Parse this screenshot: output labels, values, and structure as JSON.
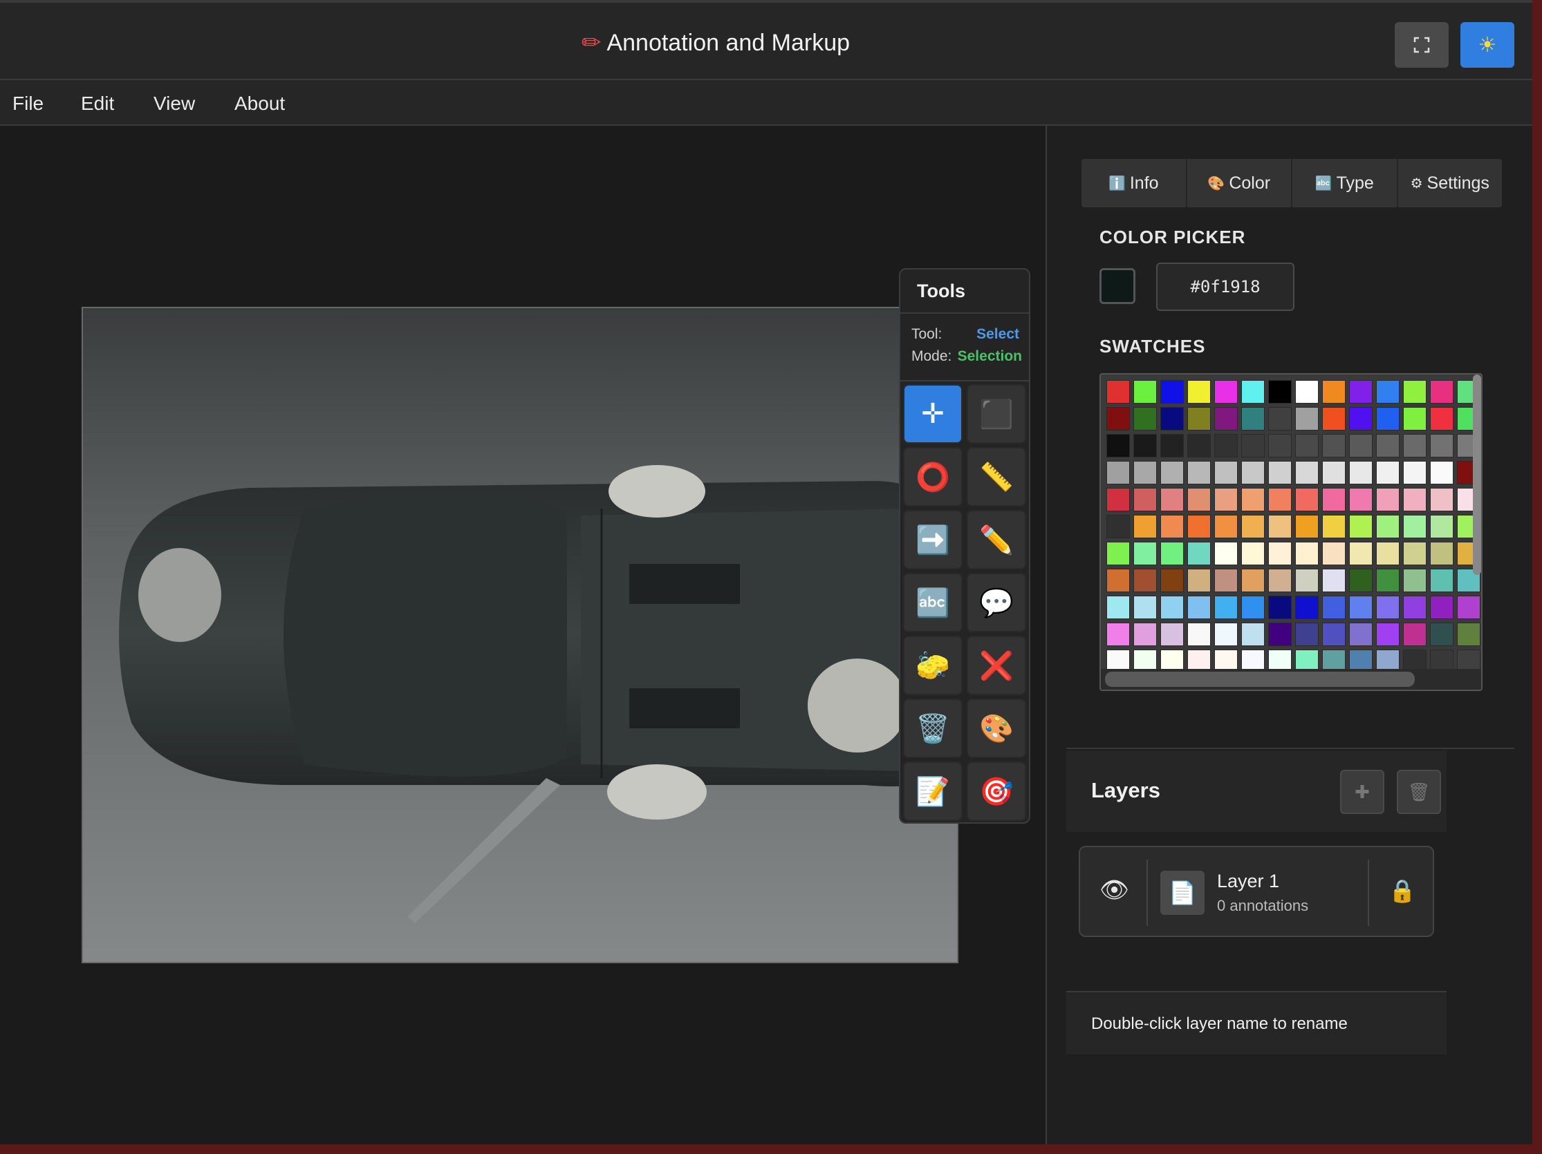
{
  "window": {
    "title": "Annotation and Markup",
    "title_icon": "pencil-icon",
    "fullscreen_icon": "fullscreen-icon",
    "theme_icon": "sun-icon"
  },
  "menu": [
    "File",
    "Edit",
    "View",
    "About"
  ],
  "tools_panel": {
    "title": "Tools",
    "tool_label": "Tool:",
    "tool_value": "Select",
    "mode_label": "Mode:",
    "mode_value": "Selection",
    "tools": [
      {
        "name": "select",
        "icon": "✛",
        "active": true
      },
      {
        "name": "rectangle",
        "icon": "⬛"
      },
      {
        "name": "circle",
        "icon": "⭕"
      },
      {
        "name": "line",
        "icon": "📏"
      },
      {
        "name": "arrow",
        "icon": "➡️"
      },
      {
        "name": "pencil",
        "icon": "✏️"
      },
      {
        "name": "text",
        "icon": "🔤"
      },
      {
        "name": "callout",
        "icon": "💬"
      },
      {
        "name": "eraser",
        "icon": "🧽"
      },
      {
        "name": "delete",
        "icon": "❌"
      },
      {
        "name": "trash",
        "icon": "🗑️"
      },
      {
        "name": "palette",
        "icon": "🎨"
      },
      {
        "name": "notes",
        "icon": "📝"
      },
      {
        "name": "target",
        "icon": "🎯"
      }
    ]
  },
  "sidebar": {
    "tabs": [
      {
        "icon": "ℹ️",
        "label": "Info"
      },
      {
        "icon": "🎨",
        "label": "Color"
      },
      {
        "icon": "🔤",
        "label": "Type"
      },
      {
        "icon": "⚙",
        "label": "Settings"
      }
    ],
    "color_picker_title": "COLOR PICKER",
    "current_color": "#0f1918",
    "swatches_title": "SWATCHES",
    "swatches": [
      [
        "#e03030",
        "#6cf040",
        "#1010e8",
        "#f0f030",
        "#e830e8",
        "#60f0f0",
        "#000000",
        "#ffffff",
        "#f08a20",
        "#8020e8",
        "#3080f0",
        "#90f040",
        "#e83080",
        "#60e080"
      ],
      [
        "#801010",
        "#307020",
        "#0a0a80",
        "#808020",
        "#801880",
        "#308080",
        "#404040",
        "#a0a0a0",
        "#f05020",
        "#5010f0",
        "#2060f0",
        "#80f040",
        "#f03040",
        "#50e060"
      ],
      [
        "#101010",
        "#1a1a1a",
        "#222222",
        "#2a2a2a",
        "#323232",
        "#3a3a3a",
        "#424242",
        "#4a4a4a",
        "#525252",
        "#5a5a5a",
        "#626262",
        "#6a6a6a",
        "#727272",
        "#7a7a7a"
      ],
      [
        "#a0a0a0",
        "#a8a8a8",
        "#b0b0b0",
        "#b8b8b8",
        "#c0c0c0",
        "#c8c8c8",
        "#d0d0d0",
        "#d8d8d8",
        "#e0e0e0",
        "#e8e8e8",
        "#f0f0f0",
        "#f4f4f4",
        "#fafafa",
        "#801010"
      ],
      [
        "#d03040",
        "#d06060",
        "#e08080",
        "#e09070",
        "#e8a080",
        "#f0a070",
        "#f08060",
        "#f06a60",
        "#f06aa0",
        "#f07ab0",
        "#f0a0b8",
        "#f0b0c0",
        "#f0c0c8",
        "#f8e0e8"
      ],
      [
        "#303030",
        "#f0a030",
        "#f08a50",
        "#f07030",
        "#f09040",
        "#f0b050",
        "#f0c080",
        "#f0a020",
        "#f0d040",
        "#b0f050",
        "#a0f080",
        "#a0f0a0",
        "#b0e8a0",
        "#a0f060"
      ],
      [
        "#80f050",
        "#80f0a0",
        "#70f080",
        "#70d8c0",
        "#fffff0",
        "#fff8d8",
        "#fff0d8",
        "#fff0d0",
        "#f8e0c0",
        "#f0e8b0",
        "#e8e0a0",
        "#d0d090",
        "#c0c080",
        "#e0b040"
      ],
      [
        "#d07030",
        "#a05030",
        "#804010",
        "#d0b080",
        "#c09080",
        "#e0a060",
        "#d0b090",
        "#d0d0c0",
        "#e0e0f0",
        "#306020",
        "#409040",
        "#90c090",
        "#60c0b0",
        "#60c0c0"
      ],
      [
        "#a0e8f0",
        "#b0e0f0",
        "#90d0f0",
        "#80c0f0",
        "#40b0f0",
        "#3090f0",
        "#0a0a80",
        "#1010d0",
        "#4060e0",
        "#6080f0",
        "#8070f0",
        "#9040e0",
        "#9020c0",
        "#b040d0"
      ],
      [
        "#f080e8",
        "#e0a0e0",
        "#d8c0e0",
        "#f8f8f8",
        "#f0f8ff",
        "#c0e0f0",
        "#400080",
        "#404090",
        "#5050c0",
        "#8070d0",
        "#a040f0",
        "#c03090",
        "#305050",
        "#608040"
      ],
      [
        "#fafafa",
        "#f0fff0",
        "#fffff0",
        "#fff0f0",
        "#fff8f0",
        "#f8f8ff",
        "#f0fff8",
        "#80f0c0",
        "#60a0a0",
        "#5080b0",
        "#90a8d0",
        "#303030",
        "#383838",
        "#404040"
      ]
    ]
  },
  "layers": {
    "title": "Layers",
    "add_icon": "plus-icon",
    "delete_icon": "trash-icon",
    "items": [
      {
        "name": "Layer 1",
        "count": "0 annotations"
      }
    ],
    "hint": "Double-click layer name to rename"
  }
}
